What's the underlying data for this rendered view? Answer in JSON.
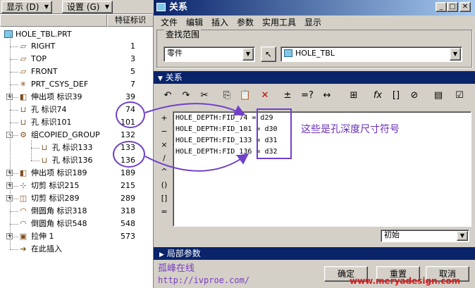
{
  "left_panel": {
    "menu": [
      {
        "label": "显示 (D)"
      },
      {
        "label": "设置 (G)"
      }
    ],
    "column_header": "特征标识",
    "root": "HOLE_TBL.PRT",
    "items": [
      {
        "label": "RIGHT",
        "value": "1",
        "icon": "datum-plane-icon",
        "glyph": "▱",
        "expand": ""
      },
      {
        "label": "TOP",
        "value": "3",
        "icon": "datum-plane-icon",
        "glyph": "▱",
        "expand": ""
      },
      {
        "label": "FRONT",
        "value": "5",
        "icon": "datum-plane-icon",
        "glyph": "▱",
        "expand": ""
      },
      {
        "label": "PRT_CSYS_DEF",
        "value": "7",
        "icon": "csys-icon",
        "glyph": "✳",
        "expand": ""
      },
      {
        "label": "伸出项 标识39",
        "value": "39",
        "icon": "protrusion-icon",
        "glyph": "◧",
        "expand": "+"
      },
      {
        "label": "孔 标识74",
        "value": "74",
        "icon": "hole-icon",
        "glyph": "⊔",
        "expand": ""
      },
      {
        "label": "孔 标识101",
        "value": "101",
        "icon": "hole-icon",
        "glyph": "⊔",
        "expand": ""
      },
      {
        "label": "组COPIED_GROUP",
        "value": "132",
        "icon": "group-icon",
        "glyph": "⚙",
        "expand": "-"
      },
      {
        "label": "孔 标识133",
        "value": "133",
        "icon": "hole-icon",
        "glyph": "⊔",
        "expand": ""
      },
      {
        "label": "孔 标识136",
        "value": "136",
        "icon": "hole-icon",
        "glyph": "⊔",
        "expand": ""
      },
      {
        "label": "伸出项 标识189",
        "value": "189",
        "icon": "protrusion-icon",
        "glyph": "◧",
        "expand": "+"
      },
      {
        "label": "切剪 标识215",
        "value": "215",
        "icon": "cut-icon",
        "glyph": "⊹",
        "expand": "+"
      },
      {
        "label": "切剪 标识289",
        "value": "289",
        "icon": "cut-icon",
        "glyph": "◫",
        "expand": "+"
      },
      {
        "label": "倒圆角 标识318",
        "value": "318",
        "icon": "round-icon",
        "glyph": "◠",
        "expand": ""
      },
      {
        "label": "倒圆角 标识548",
        "value": "548",
        "icon": "round-icon",
        "glyph": "◠",
        "expand": ""
      },
      {
        "label": "拉伸 1",
        "value": "573",
        "icon": "extrude-icon",
        "glyph": "▣",
        "expand": "+"
      },
      {
        "label": "在此插入",
        "value": "",
        "icon": "insert-here-icon",
        "glyph": "➔",
        "expand": ""
      }
    ]
  },
  "dialog": {
    "title": "关系",
    "menu": [
      "文件",
      "编辑",
      "插入",
      "参数",
      "实用工具",
      "显示"
    ],
    "search_scope_label": "查找范围",
    "scope_select": "零件",
    "model_select": "HOLE_TBL",
    "relations_header": "关系",
    "toolbar_glyphs": [
      "↶",
      "↷",
      "✂",
      "⎘",
      "📋",
      "✕",
      "±",
      "=?",
      "↔",
      "⊞",
      "fx",
      "[]",
      "⊘",
      "▤",
      "☑"
    ],
    "side_buttons": [
      "+",
      "−",
      "×",
      "/",
      "^",
      "()",
      "[]",
      "="
    ],
    "relations": [
      {
        "left": "HOLE_DEPTH:FID_74 = ",
        "right": "d29"
      },
      {
        "left": "HOLE_DEPTH:FID_101 = ",
        "right": "d30"
      },
      {
        "left": "HOLE_DEPTH:FID_133 = ",
        "right": "d31"
      },
      {
        "left": "HOLE_DEPTH:FID_136 = ",
        "right": "d32"
      }
    ],
    "annotation": "这些是孔深度尺寸符号",
    "view_select": "初始",
    "local_params": "局部参数",
    "buttons": {
      "ok": "确定",
      "reset": "重置",
      "cancel": "取消"
    }
  },
  "watermarks": {
    "site_name": "孤峰在线",
    "site_url": "http://ivproe.com/",
    "brand": "www.meryadesign.com"
  },
  "colors": {
    "title_bar": "#0a246a",
    "annotation": "#6a30b8"
  }
}
